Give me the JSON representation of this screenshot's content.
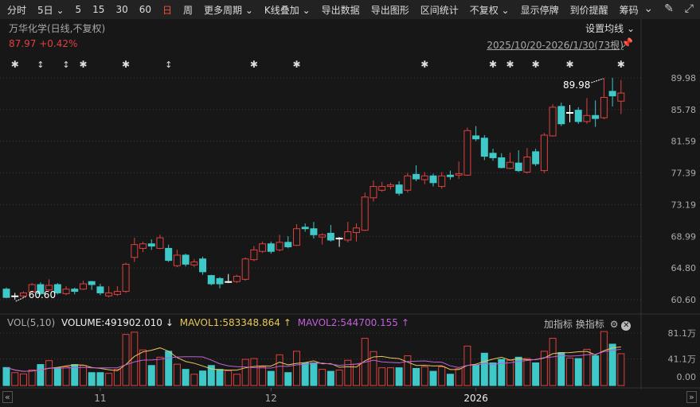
{
  "toolbar": {
    "items": [
      "分时",
      "5日 ⌄",
      "5",
      "15",
      "30",
      "60",
      "日",
      "周",
      "更多周期 ⌄",
      "K线叠加 ⌄",
      "导出数据",
      "导出图形",
      "区间统计",
      "不复权 ⌄",
      "显示停牌",
      "到价提醒",
      "筹码"
    ],
    "active": "日",
    "icons": [
      "chevron-circle-icon",
      "brush-icon",
      "fullscreen-icon"
    ]
  },
  "header": {
    "title": "万华化学(日线,不复权)",
    "price": "87.97",
    "change": "+0.42%",
    "ma_setting": "设置均线 ⌄",
    "range": "2025/10/20-2026/1/30(73根)"
  },
  "colors": {
    "up": "#e0403f",
    "down": "#3ec8c8",
    "doji": "#ffffff",
    "mavol1": "#e8c55a",
    "mavol2": "#c060d8",
    "background": "#171717"
  },
  "chart_data": [
    {
      "type": "candlestick",
      "count": 73,
      "ylim": [
        60.6,
        89.98
      ],
      "y_ticks": [
        "89.98",
        "85.78",
        "81.59",
        "77.39",
        "73.19",
        "68.99",
        "64.80",
        "60.60"
      ],
      "x_ticks": [
        {
          "label": "11",
          "index": 11
        },
        {
          "label": "12",
          "index": 31
        },
        {
          "label": "2026",
          "index": 55
        }
      ],
      "annotations": [
        {
          "label": "89.98",
          "index": 70,
          "kind": "high"
        },
        {
          "label": "60.60",
          "index": 1,
          "kind": "low"
        }
      ],
      "markers": [
        {
          "index": 1,
          "icon": "star"
        },
        {
          "index": 4,
          "icon": "updown"
        },
        {
          "index": 7,
          "icon": "updown"
        },
        {
          "index": 9,
          "icon": "star"
        },
        {
          "index": 14,
          "icon": "star"
        },
        {
          "index": 19,
          "icon": "updown"
        },
        {
          "index": 29,
          "icon": "star"
        },
        {
          "index": 34,
          "icon": "star"
        },
        {
          "index": 49,
          "icon": "star"
        },
        {
          "index": 57,
          "icon": "star"
        },
        {
          "index": 59,
          "icon": "star"
        },
        {
          "index": 62,
          "icon": "star"
        },
        {
          "index": 66,
          "icon": "star"
        },
        {
          "index": 72,
          "icon": "star"
        }
      ],
      "ohlc": [
        [
          62.0,
          62.2,
          60.8,
          60.9
        ],
        [
          61.1,
          61.5,
          60.6,
          61.1
        ],
        [
          61.1,
          61.7,
          60.9,
          61.5
        ],
        [
          61.6,
          62.8,
          61.4,
          62.6
        ],
        [
          62.6,
          62.9,
          61.2,
          61.4
        ],
        [
          61.9,
          63.3,
          61.7,
          62.5
        ],
        [
          62.6,
          62.8,
          61.3,
          61.5
        ],
        [
          61.4,
          62.4,
          61.2,
          62.0
        ],
        [
          62.0,
          62.2,
          61.3,
          61.7
        ],
        [
          62.0,
          63.1,
          61.9,
          62.7
        ],
        [
          63.0,
          63.1,
          61.9,
          62.6
        ],
        [
          62.3,
          62.7,
          61.2,
          61.5
        ],
        [
          61.1,
          62.4,
          60.9,
          61.5
        ],
        [
          61.3,
          62.4,
          61.1,
          61.7
        ],
        [
          61.7,
          65.5,
          61.5,
          65.3
        ],
        [
          66.2,
          68.8,
          65.6,
          67.9
        ],
        [
          67.4,
          68.3,
          66.9,
          68.0
        ],
        [
          68.0,
          68.6,
          67.2,
          67.7
        ],
        [
          67.4,
          69.2,
          67.3,
          68.8
        ],
        [
          67.4,
          67.9,
          65.6,
          65.8
        ],
        [
          65.1,
          67.2,
          64.9,
          66.5
        ],
        [
          66.5,
          66.7,
          65.0,
          65.3
        ],
        [
          65.2,
          66.0,
          64.9,
          65.6
        ],
        [
          66.0,
          66.3,
          63.9,
          64.3
        ],
        [
          63.8,
          63.9,
          62.5,
          62.7
        ],
        [
          63.4,
          63.6,
          62.1,
          62.7
        ],
        [
          63.0,
          64.0,
          62.8,
          63.0
        ],
        [
          63.0,
          63.9,
          62.8,
          63.7
        ],
        [
          63.3,
          66.2,
          63.1,
          66.0
        ],
        [
          65.9,
          67.7,
          65.7,
          67.2
        ],
        [
          67.0,
          68.3,
          66.8,
          68.0
        ],
        [
          68.0,
          68.3,
          66.7,
          67.0
        ],
        [
          67.2,
          69.2,
          67.0,
          68.2
        ],
        [
          68.2,
          69.0,
          67.4,
          67.6
        ],
        [
          67.8,
          70.6,
          67.7,
          70.0
        ],
        [
          70.2,
          70.7,
          69.6,
          70.0
        ],
        [
          70.0,
          70.9,
          68.7,
          69.2
        ],
        [
          68.9,
          69.4,
          67.9,
          69.2
        ],
        [
          69.4,
          70.5,
          68.3,
          68.5
        ],
        [
          68.75,
          68.9,
          67.6,
          68.75
        ],
        [
          68.5,
          70.9,
          68.2,
          69.6
        ],
        [
          69.5,
          70.7,
          68.3,
          70.1
        ],
        [
          69.8,
          74.8,
          69.7,
          74.2
        ],
        [
          74.1,
          76.4,
          73.6,
          75.6
        ],
        [
          75.1,
          76.2,
          74.9,
          75.6
        ],
        [
          75.6,
          76.1,
          75.2,
          75.8
        ],
        [
          75.8,
          76.3,
          74.4,
          74.7
        ],
        [
          75.1,
          77.4,
          74.8,
          77.0
        ],
        [
          77.2,
          78.4,
          76.3,
          76.6
        ],
        [
          76.5,
          77.5,
          75.9,
          77.0
        ],
        [
          77.0,
          77.3,
          75.6,
          76.1
        ],
        [
          75.6,
          77.5,
          75.3,
          77.0
        ],
        [
          77.1,
          77.7,
          76.5,
          76.9
        ],
        [
          77.1,
          78.9,
          76.6,
          77.3
        ],
        [
          77.1,
          83.4,
          77.0,
          83.0
        ],
        [
          82.3,
          83.6,
          81.6,
          81.9
        ],
        [
          82.0,
          82.4,
          79.1,
          79.6
        ],
        [
          80.0,
          80.6,
          79.0,
          79.4
        ],
        [
          79.4,
          80.0,
          78.0,
          78.1
        ],
        [
          78.0,
          80.1,
          77.9,
          78.8
        ],
        [
          78.7,
          80.4,
          77.5,
          77.7
        ],
        [
          77.5,
          80.7,
          77.3,
          79.5
        ],
        [
          80.2,
          80.6,
          78.3,
          78.6
        ],
        [
          77.7,
          82.7,
          77.4,
          82.4
        ],
        [
          82.3,
          86.5,
          82.2,
          86.1
        ],
        [
          86.2,
          86.7,
          83.6,
          83.9
        ],
        [
          85.4,
          86.4,
          84.1,
          85.4
        ],
        [
          85.7,
          86.1,
          83.9,
          84.2
        ],
        [
          84.2,
          87.3,
          83.9,
          85.0
        ],
        [
          85.0,
          87.0,
          83.5,
          84.6
        ],
        [
          84.7,
          89.98,
          84.5,
          87.4
        ],
        [
          88.2,
          89.98,
          86.2,
          87.6
        ],
        [
          86.9,
          89.7,
          85.2,
          87.97
        ]
      ]
    },
    {
      "type": "bar",
      "title": "VOL(5,10)",
      "volume_label": "VOLUME:491902.010",
      "volume_dir": "↓",
      "mavol1_label": "MAVOL1:583348.864",
      "mavol1_dir": "↑",
      "mavol2_label": "MAVOL2:544700.155",
      "mavol2_dir": "↑",
      "unit": "万",
      "y_ticks": [
        "81.1万",
        "41.1万",
        "0.00"
      ],
      "ylim": [
        0,
        81.1
      ],
      "values": [
        27.9,
        20,
        18,
        24,
        32.5,
        38.5,
        27.5,
        29,
        32.5,
        31,
        20,
        20,
        18.8,
        25,
        79,
        82.5,
        55,
        31,
        43.8,
        53,
        33,
        25,
        17.5,
        22.5,
        31,
        25,
        23,
        17.5,
        40.5,
        41.7,
        29,
        22,
        47.5,
        20,
        53,
        35,
        35,
        25,
        22,
        24,
        39,
        33,
        73,
        52.5,
        27.5,
        27.5,
        27.5,
        46,
        26.5,
        29,
        22,
        29,
        17.5,
        26,
        61,
        32,
        50,
        35,
        40.5,
        39,
        43.8,
        41.7,
        35,
        53,
        73,
        51,
        42.5,
        41.7,
        56,
        46,
        83.5,
        64,
        49.2
      ]
    }
  ],
  "vol_tools": {
    "add": "加指标",
    "switch": "换指标"
  },
  "nav": {
    "left": "«",
    "right": "»"
  }
}
